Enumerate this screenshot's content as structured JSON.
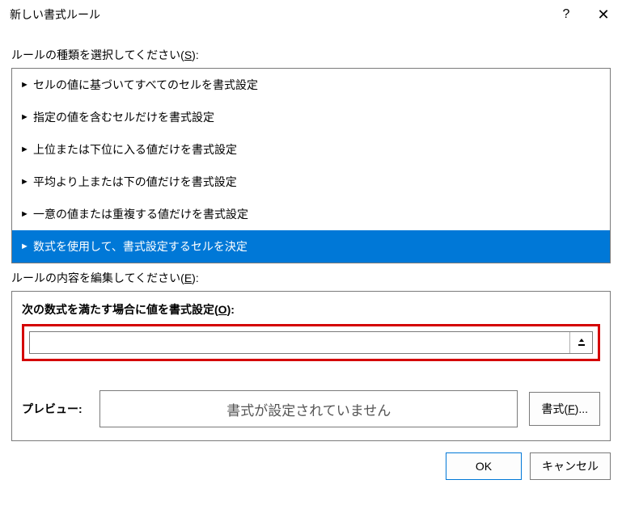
{
  "titlebar": {
    "title": "新しい書式ルール",
    "help": "?",
    "close": "✕"
  },
  "ruleTypeSection": {
    "label_prefix": "ルールの種類を選択してください(",
    "label_key": "S",
    "label_suffix": "):",
    "items": [
      "セルの値に基づいてすべてのセルを書式設定",
      "指定の値を含むセルだけを書式設定",
      "上位または下位に入る値だけを書式設定",
      "平均より上または下の値だけを書式設定",
      "一意の値または重複する値だけを書式設定",
      "数式を使用して、書式設定するセルを決定"
    ],
    "selected_index": 5
  },
  "ruleEditSection": {
    "label_prefix": "ルールの内容を編集してください(",
    "label_key": "E",
    "label_suffix": "):",
    "formula_label_prefix": "次の数式を満たす場合に値を書式設定(",
    "formula_label_key": "O",
    "formula_label_suffix": "):",
    "formula_value": "",
    "preview_label": "プレビュー:",
    "preview_text": "書式が設定されていません",
    "format_btn_prefix": "書式(",
    "format_btn_key": "F",
    "format_btn_suffix": ")..."
  },
  "buttons": {
    "ok": "OK",
    "cancel": "キャンセル"
  }
}
